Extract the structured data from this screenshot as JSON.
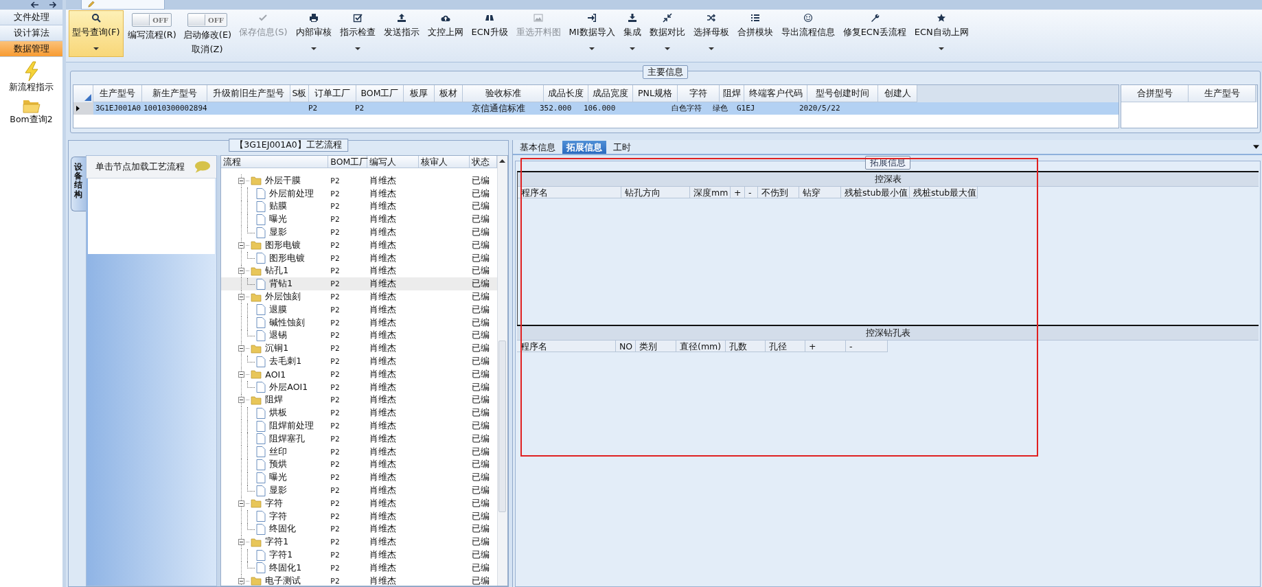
{
  "nav": {
    "items": [
      {
        "label": "文件处理",
        "selected": false
      },
      {
        "label": "设计算法",
        "selected": false
      },
      {
        "label": "数据管理",
        "selected": true
      }
    ],
    "shortcuts": [
      {
        "label": "新流程指示"
      },
      {
        "label": "Bom查询2"
      }
    ]
  },
  "toolbar": [
    {
      "kind": "button",
      "label": "型号查询(F)",
      "selected": true,
      "disabled": false,
      "dropdown": true
    },
    {
      "kind": "toggle",
      "label": "编写流程(R)",
      "switch_text": "OFF",
      "on": false
    },
    {
      "kind": "toggle",
      "label": "启动修改(E)",
      "sub_label": "取消(Z)",
      "switch_text": "OFF",
      "on": false
    },
    {
      "kind": "button",
      "label": "保存信息(S)",
      "selected": false,
      "disabled": true,
      "dropdown": false
    },
    {
      "kind": "button",
      "label": "内部审核",
      "selected": false,
      "disabled": false,
      "dropdown": true
    },
    {
      "kind": "button",
      "label": "指示检查",
      "selected": false,
      "disabled": false,
      "dropdown": true
    },
    {
      "kind": "button",
      "label": "发送指示",
      "selected": false,
      "disabled": false,
      "dropdown": false
    },
    {
      "kind": "button",
      "label": "文控上网",
      "selected": false,
      "disabled": false,
      "dropdown": false
    },
    {
      "kind": "button",
      "label": "ECN升级",
      "selected": false,
      "disabled": false,
      "dropdown": false
    },
    {
      "kind": "button",
      "label": "重选开料图",
      "selected": false,
      "disabled": true,
      "dropdown": false
    },
    {
      "kind": "button",
      "label": "MI数据导入",
      "selected": false,
      "disabled": false,
      "dropdown": true
    },
    {
      "kind": "button",
      "label": "集成",
      "selected": false,
      "disabled": false,
      "dropdown": true
    },
    {
      "kind": "button",
      "label": "数据对比",
      "selected": false,
      "disabled": false,
      "dropdown": true
    },
    {
      "kind": "button",
      "label": "选择母板",
      "selected": false,
      "disabled": false,
      "dropdown": true
    },
    {
      "kind": "button",
      "label": "合拼模块",
      "selected": false,
      "disabled": false,
      "dropdown": false
    },
    {
      "kind": "button",
      "label": "导出流程信息",
      "selected": false,
      "disabled": false,
      "dropdown": false
    },
    {
      "kind": "button",
      "label": "修复ECN丢流程",
      "selected": false,
      "disabled": false,
      "dropdown": false
    },
    {
      "kind": "button",
      "label": "ECN自动上网",
      "selected": false,
      "disabled": false,
      "dropdown": true
    }
  ],
  "main_info": {
    "title": "主要信息",
    "columns": [
      "生产型号",
      "新生产型号",
      "升级前旧生产型号",
      "S板",
      "订单工厂",
      "BOM工厂",
      "板厚",
      "板材",
      "验收标准",
      "成品长度",
      "成品宽度",
      "PNL规格",
      "字符",
      "阻焊",
      "终端客户代码",
      "型号创建时间",
      "创建人"
    ],
    "rows": [
      {
        "selected": true,
        "cells": [
          "3G1EJ001A0",
          "10010300002894",
          null,
          null,
          "P2",
          "P2",
          null,
          null,
          "京信通信标准",
          "352.000",
          "106.000",
          null,
          "白色字符",
          "绿色",
          "G1EJ",
          "2020/5/22",
          null
        ]
      }
    ],
    "merge_columns": [
      "合拼型号",
      "生产型号"
    ]
  },
  "process": {
    "title": "【3G1EJ001A0】工艺流程",
    "side_tab": "设备结构",
    "hint": "单击节点加载工艺流程",
    "columns": [
      "流程",
      "BOM工厂",
      "编写人",
      "核审人",
      "状态"
    ],
    "tree": [
      {
        "label": "外层干膜",
        "bom": "P2",
        "writer": "肖维杰",
        "status": "已编",
        "selected": false,
        "expanded": true,
        "children": [
          {
            "label": "外层前处理",
            "bom": "P2",
            "writer": "肖维杰",
            "status": "已编",
            "selected": false
          },
          {
            "label": "贴膜",
            "bom": "P2",
            "writer": "肖维杰",
            "status": "已编",
            "selected": false
          },
          {
            "label": "曝光",
            "bom": "P2",
            "writer": "肖维杰",
            "status": "已编",
            "selected": false
          },
          {
            "label": "显影",
            "bom": "P2",
            "writer": "肖维杰",
            "status": "已编",
            "selected": false
          }
        ]
      },
      {
        "label": "图形电镀",
        "bom": "P2",
        "writer": "肖维杰",
        "status": "已编",
        "selected": false,
        "expanded": true,
        "children": [
          {
            "label": "图形电镀",
            "bom": "P2",
            "writer": "肖维杰",
            "status": "已编",
            "selected": false
          }
        ]
      },
      {
        "label": "钻孔1",
        "bom": "P2",
        "writer": "肖维杰",
        "status": "已编",
        "selected": false,
        "expanded": true,
        "children": [
          {
            "label": "背钻1",
            "bom": "P2",
            "writer": "肖维杰",
            "status": "已编",
            "selected": true
          }
        ]
      },
      {
        "label": "外层蚀刻",
        "bom": "P2",
        "writer": "肖维杰",
        "status": "已编",
        "selected": false,
        "expanded": true,
        "children": [
          {
            "label": "退膜",
            "bom": "P2",
            "writer": "肖维杰",
            "status": "已编",
            "selected": false
          },
          {
            "label": "碱性蚀刻",
            "bom": "P2",
            "writer": "肖维杰",
            "status": "已编",
            "selected": false
          },
          {
            "label": "退锡",
            "bom": "P2",
            "writer": "肖维杰",
            "status": "已编",
            "selected": false
          }
        ]
      },
      {
        "label": "沉铜1",
        "bom": "P2",
        "writer": "肖维杰",
        "status": "已编",
        "selected": false,
        "expanded": true,
        "children": [
          {
            "label": "去毛刺1",
            "bom": "P2",
            "writer": "肖维杰",
            "status": "已编",
            "selected": false
          }
        ]
      },
      {
        "label": "AOI1",
        "bom": "P2",
        "writer": "肖维杰",
        "status": "已编",
        "selected": false,
        "expanded": true,
        "children": [
          {
            "label": "外层AOI1",
            "bom": "P2",
            "writer": "肖维杰",
            "status": "已编",
            "selected": false
          }
        ]
      },
      {
        "label": "阻焊",
        "bom": "P2",
        "writer": "肖维杰",
        "status": "已编",
        "selected": false,
        "expanded": true,
        "children": [
          {
            "label": "烘板",
            "bom": "P2",
            "writer": "肖维杰",
            "status": "已编",
            "selected": false
          },
          {
            "label": "阻焊前处理",
            "bom": "P2",
            "writer": "肖维杰",
            "status": "已编",
            "selected": false
          },
          {
            "label": "阻焊塞孔",
            "bom": "P2",
            "writer": "肖维杰",
            "status": "已编",
            "selected": false
          },
          {
            "label": "丝印",
            "bom": "P2",
            "writer": "肖维杰",
            "status": "已编",
            "selected": false
          },
          {
            "label": "预烘",
            "bom": "P2",
            "writer": "肖维杰",
            "status": "已编",
            "selected": false
          },
          {
            "label": "曝光",
            "bom": "P2",
            "writer": "肖维杰",
            "status": "已编",
            "selected": false
          },
          {
            "label": "显影",
            "bom": "P2",
            "writer": "肖维杰",
            "status": "已编",
            "selected": false
          }
        ]
      },
      {
        "label": "字符",
        "bom": "P2",
        "writer": "肖维杰",
        "status": "已编",
        "selected": false,
        "expanded": true,
        "children": [
          {
            "label": "字符",
            "bom": "P2",
            "writer": "肖维杰",
            "status": "已编",
            "selected": false
          },
          {
            "label": "终固化",
            "bom": "P2",
            "writer": "肖维杰",
            "status": "已编",
            "selected": false
          }
        ]
      },
      {
        "label": "字符1",
        "bom": "P2",
        "writer": "肖维杰",
        "status": "已编",
        "selected": false,
        "expanded": true,
        "children": [
          {
            "label": "字符1",
            "bom": "P2",
            "writer": "肖维杰",
            "status": "已编",
            "selected": false
          },
          {
            "label": "终固化1",
            "bom": "P2",
            "writer": "肖维杰",
            "status": "已编",
            "selected": false
          }
        ]
      },
      {
        "label": "电子测试",
        "bom": "P2",
        "writer": "肖维杰",
        "status": "已编",
        "selected": false,
        "expanded": true
      }
    ]
  },
  "detail": {
    "tabs": [
      {
        "label": "基本信息",
        "selected": false
      },
      {
        "label": "拓展信息",
        "selected": true
      },
      {
        "label": "工时",
        "selected": false
      }
    ],
    "group_title": "拓展信息",
    "tables": [
      {
        "title": "控深表",
        "columns": [
          "程序名",
          "钻孔方向",
          "深度mm",
          "+",
          "-",
          "不伤到",
          "钻穿",
          "残桩stub最小值",
          "残桩stub最大值"
        ]
      },
      {
        "title": "控深钻孔表",
        "columns": [
          "程序名",
          "NO",
          "类别",
          "直径(mm)",
          "孔数",
          "孔径",
          "+",
          "-"
        ]
      }
    ]
  }
}
